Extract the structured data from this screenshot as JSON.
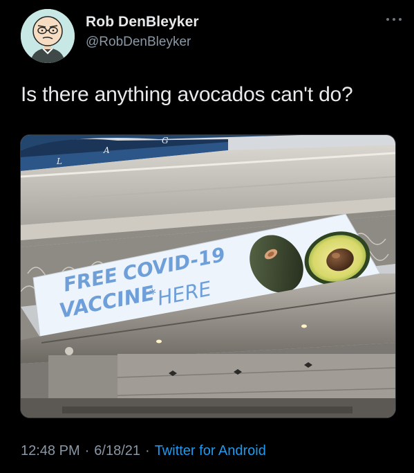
{
  "author": {
    "display_name": "Rob DenBleyker",
    "handle": "@RobDenBleyker"
  },
  "more_icon": "more-horizontal-icon",
  "tweet": {
    "text": "Is there anything avocados can't do?"
  },
  "media": {
    "banner": {
      "line1_word1": "FREE",
      "line1_word2": "COVID-19",
      "line2_word1": "VACCINE",
      "line2_mark": "*",
      "line2_word2": "HERE"
    },
    "sign_letters": [
      "L",
      "A",
      "G"
    ]
  },
  "meta": {
    "time": "12:48 PM",
    "separator": "·",
    "date": "6/18/21",
    "source": "Twitter for Android"
  },
  "colors": {
    "background": "#000000",
    "text_primary": "#e7e9ea",
    "text_secondary": "#8b98a5",
    "link": "#1d9bf0",
    "avatar_bg": "#c7e8e4"
  }
}
